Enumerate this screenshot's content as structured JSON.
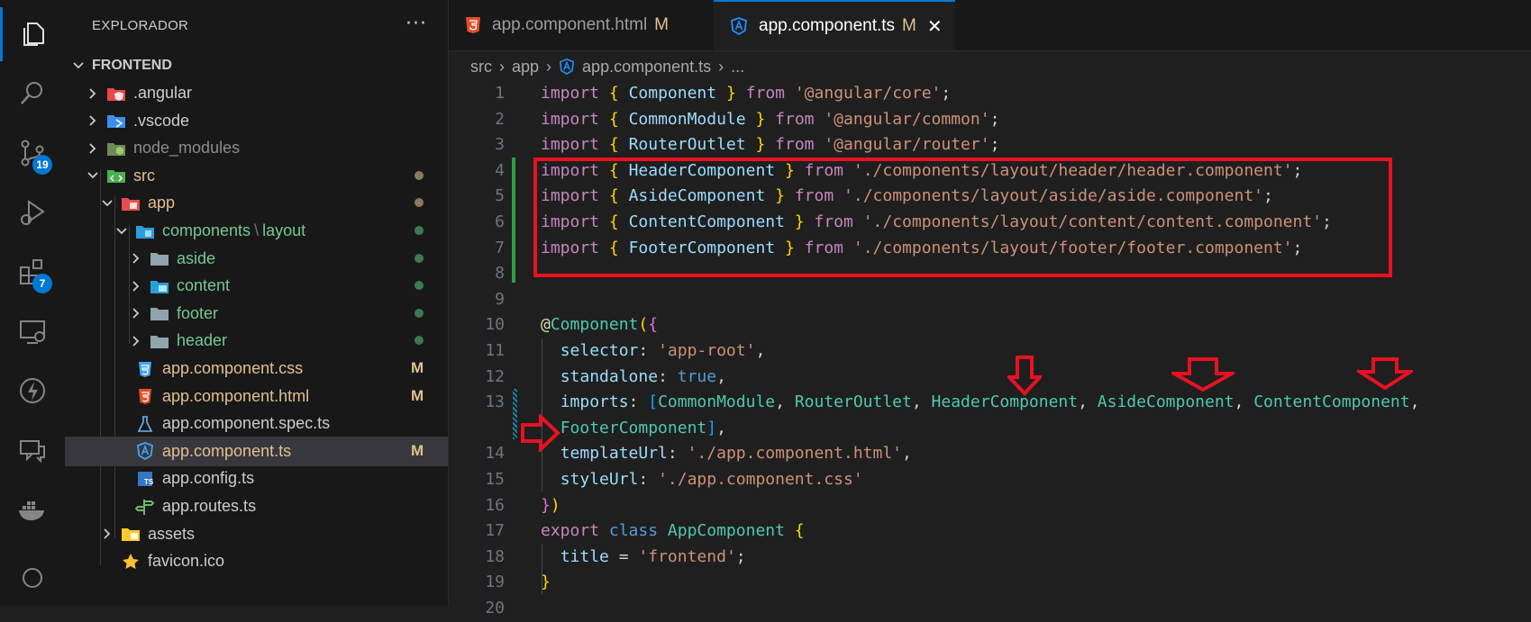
{
  "activity_bar": {
    "items": [
      {
        "name": "explorer-icon",
        "badge": ""
      },
      {
        "name": "search-icon",
        "badge": ""
      },
      {
        "name": "source-control-icon",
        "badge": "19"
      },
      {
        "name": "run-debug-icon",
        "badge": ""
      },
      {
        "name": "extensions-icon",
        "badge": "7"
      },
      {
        "name": "remote-explorer-icon",
        "badge": ""
      },
      {
        "name": "lightning-icon",
        "badge": ""
      },
      {
        "name": "chat-icon",
        "badge": ""
      },
      {
        "name": "docker-icon",
        "badge": ""
      }
    ]
  },
  "sidebar": {
    "title": "EXPLORADOR",
    "more": "···",
    "root": "FRONTEND",
    "tree": [
      {
        "label": ".angular",
        "color": "#cccccc",
        "icon": "angular-folder-icon",
        "mark": "",
        "dot": ""
      },
      {
        "label": ".vscode",
        "color": "#cccccc",
        "icon": "vscode-folder-icon",
        "mark": "",
        "dot": ""
      },
      {
        "label": "node_modules",
        "color": "#8c8c8c",
        "icon": "node-folder-icon",
        "mark": "",
        "dot": ""
      },
      {
        "label": "src",
        "color": "#e2c08d",
        "icon": "src-folder-icon",
        "mark": "",
        "dot": "#8a7a5a"
      },
      {
        "label": "app",
        "color": "#e2c08d",
        "icon": "app-folder-icon",
        "mark": "",
        "dot": "#8a7a5a"
      },
      {
        "label": "components",
        "label2": "layout",
        "color": "#73c991",
        "icon": "components-folder-icon",
        "mark": "",
        "dot": "#3e7a4f"
      },
      {
        "label": "aside",
        "color": "#73c991",
        "icon": "folder-icon",
        "mark": "",
        "dot": "#3e7a4f"
      },
      {
        "label": "content",
        "color": "#73c991",
        "icon": "content-folder-icon",
        "mark": "",
        "dot": "#3e7a4f"
      },
      {
        "label": "footer",
        "color": "#73c991",
        "icon": "folder-icon",
        "mark": "",
        "dot": "#3e7a4f"
      },
      {
        "label": "header",
        "color": "#73c991",
        "icon": "folder-icon",
        "mark": "",
        "dot": "#3e7a4f"
      },
      {
        "label": "app.component.css",
        "color": "#e2c08d",
        "icon": "css-file-icon",
        "mark": "M",
        "dot": ""
      },
      {
        "label": "app.component.html",
        "color": "#e2c08d",
        "icon": "html-file-icon",
        "mark": "M",
        "dot": ""
      },
      {
        "label": "app.component.spec.ts",
        "color": "#cccccc",
        "icon": "test-flask-icon",
        "mark": "",
        "dot": ""
      },
      {
        "label": "app.component.ts",
        "color": "#e2c08d",
        "icon": "angular-file-icon",
        "mark": "M",
        "dot": ""
      },
      {
        "label": "app.config.ts",
        "color": "#cccccc",
        "icon": "typescript-file-icon",
        "mark": "",
        "dot": ""
      },
      {
        "label": "app.routes.ts",
        "color": "#cccccc",
        "icon": "routes-file-icon",
        "mark": "",
        "dot": ""
      },
      {
        "label": "assets",
        "color": "#cccccc",
        "icon": "assets-folder-icon",
        "mark": "",
        "dot": ""
      },
      {
        "label": "favicon.ico",
        "color": "#cccccc",
        "icon": "star-icon",
        "mark": "",
        "dot": ""
      }
    ]
  },
  "tabs": [
    {
      "label": "app.component.html",
      "mark": "M",
      "active": false
    },
    {
      "label": "app.component.ts",
      "mark": "M",
      "active": true,
      "close": "✕"
    }
  ],
  "breadcrumb": {
    "parts": [
      "src",
      "app",
      "app.component.ts",
      "..."
    ],
    "sep": "›"
  },
  "editor": {
    "line_numbers": [
      "1",
      "2",
      "3",
      "4",
      "5",
      "6",
      "7",
      "8",
      "9",
      "10",
      "11",
      "12",
      "13",
      "",
      "14",
      "15",
      "16",
      "17",
      "18",
      "19",
      "20"
    ]
  },
  "colors": {
    "accent": "#0078d4",
    "annotation_red": "#e81123",
    "git_added": "#2ea043",
    "git_modified": "#e2c08d",
    "git_untracked": "#73c991"
  }
}
